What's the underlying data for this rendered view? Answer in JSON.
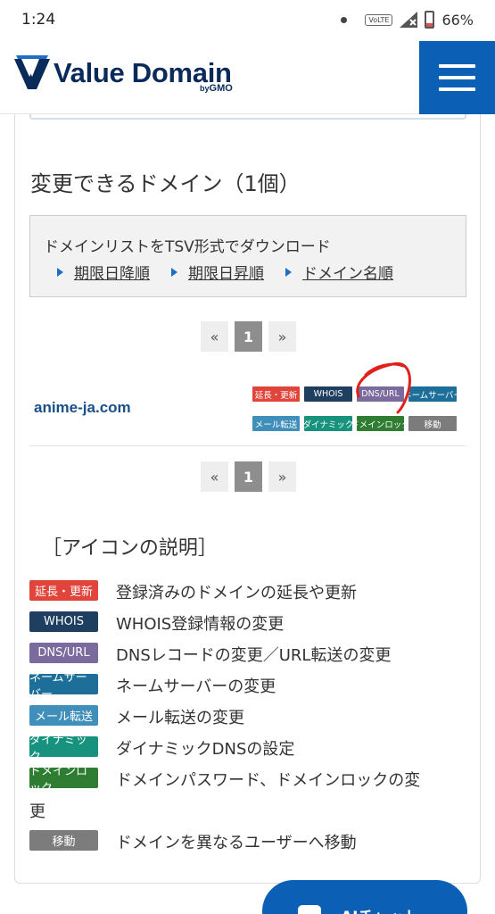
{
  "status_bar": {
    "time": "1:24",
    "battery": "66%",
    "volte": "VoLTE"
  },
  "header": {
    "logo_text": "Value Domain",
    "logo_sub_by": "by",
    "logo_sub_brand": "GMO"
  },
  "section": {
    "title": "変更できるドメイン（1個）"
  },
  "download": {
    "title": "ドメインリストをTSV形式でダウンロード",
    "links": [
      "期限日降順",
      "期限日昇順",
      "ドメイン名順"
    ]
  },
  "pager": {
    "prev": "«",
    "current": "1",
    "next": "»"
  },
  "domain": {
    "name": "anime-ja.com",
    "badges": [
      "延長・更新",
      "WHOIS",
      "DNS/URL",
      "ネームサーバー",
      "メール転送",
      "ダイナミック",
      "ドメインロック",
      "移動"
    ]
  },
  "legend": {
    "title": "［アイコンの説明］",
    "items": [
      {
        "badge": "延長・更新",
        "text": "登録済みのドメインの延長や更新",
        "color": "#e0443a"
      },
      {
        "badge": "WHOIS",
        "text": "WHOIS登録情報の変更",
        "color": "#1f3f60"
      },
      {
        "badge": "DNS/URL",
        "text": "DNSレコードの変更／URL転送の変更",
        "color": "#7a6a9e"
      },
      {
        "badge": "ネームサーバー",
        "text": "ネームサーバーの変更",
        "color": "#1d6f9a"
      },
      {
        "badge": "メール転送",
        "text": "メール転送の変更",
        "color": "#3f8fba"
      },
      {
        "badge": "ダイナミック",
        "text": "ダイナミックDNSの設定",
        "color": "#17927e"
      },
      {
        "badge": "ドメインロック",
        "text_line1": "ドメインパスワード、ドメインロックの変",
        "text_line2": "更",
        "color": "#2e7d32"
      },
      {
        "badge": "移動",
        "text": "ドメインを異なるユーザーへ移動",
        "color": "#7c7c7c"
      }
    ]
  },
  "chat": {
    "label": "AIチャット"
  },
  "colors": {
    "brand": "#0b5fb5",
    "logo": "#0a2b5a",
    "annotation": "#e0201a"
  }
}
